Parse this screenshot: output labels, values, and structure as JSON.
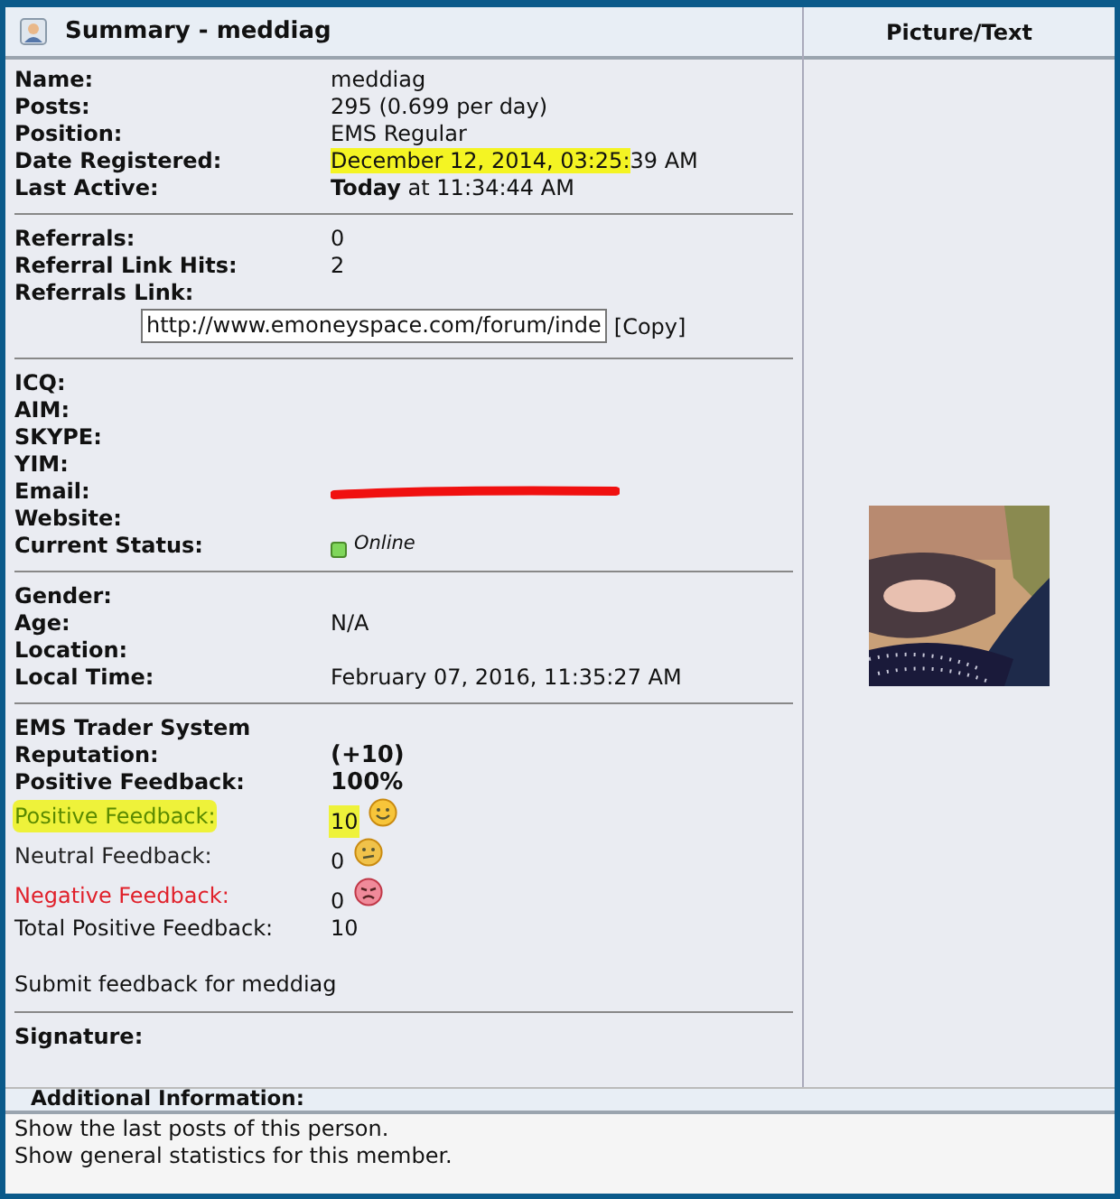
{
  "summary_header": {
    "title": "Summary - meddiag"
  },
  "picture_header": {
    "title": "Picture/Text"
  },
  "sections": [
    {
      "rows": [
        {
          "kind": "field",
          "label": "Name:",
          "value": "meddiag"
        },
        {
          "kind": "field",
          "label": "Posts:",
          "value": "295 (0.699 per day)"
        },
        {
          "kind": "field",
          "label": "Position:",
          "value": "EMS Regular"
        },
        {
          "kind": "highlighted_field",
          "label": "Date Registered:",
          "value_parts": [
            {
              "text": "December 12, 2014, 03:25:",
              "highlighted": true
            },
            {
              "text": "39 AM",
              "highlighted": false
            }
          ]
        },
        {
          "kind": "field",
          "label": "Last Active:",
          "value": "**Today** at 11:34:44 AM"
        }
      ]
    },
    {
      "rows": [
        {
          "kind": "field",
          "label": "Referrals:",
          "value": "0"
        },
        {
          "kind": "field",
          "label": "Referral Link Hits:",
          "value": "2"
        },
        {
          "kind": "link_input",
          "label": "Referrals Link:",
          "value": "http://www.emoneyspace.com/forum/inde",
          "action": "[Copy]"
        }
      ]
    },
    {
      "rows": [
        {
          "kind": "field",
          "label": "ICQ:"
        },
        {
          "kind": "field",
          "label": "AIM:"
        },
        {
          "kind": "field",
          "label": "SKYPE:"
        },
        {
          "kind": "field",
          "label": "YIM:"
        },
        {
          "kind": "redacted",
          "label": "Email:"
        },
        {
          "kind": "field",
          "label": "Website:"
        },
        {
          "kind": "status",
          "label": "Current Status:",
          "value": "Online",
          "online": true
        }
      ]
    },
    {
      "rows": [
        {
          "kind": "field",
          "label": "Gender:"
        },
        {
          "kind": "field",
          "label": "Age:",
          "value": "N/A"
        },
        {
          "kind": "field",
          "label": "Location:"
        },
        {
          "kind": "field",
          "label": "Local Time:",
          "value": "February 07, 2016, 11:35:27 AM"
        }
      ]
    },
    {
      "rows": [
        {
          "kind": "heading",
          "label": "EMS Trader System"
        },
        {
          "kind": "bold_field",
          "label": "Reputation:",
          "value": "(+10)"
        },
        {
          "kind": "bold_field",
          "label": "Positive Feedback:",
          "value": "100%"
        },
        {
          "kind": "positive_feedback",
          "label": "Positive Feedback:",
          "value": "10",
          "highlighted": true
        },
        {
          "kind": "neutral_feedback",
          "label": "Neutral Feedback:",
          "value": "0",
          "highlighted": false
        },
        {
          "kind": "negative_feedback",
          "label": "Negative Feedback:",
          "value": "0",
          "highlighted": false
        },
        {
          "kind": "plain_field",
          "label": "Total Positive Feedback:",
          "value": "10"
        },
        {
          "kind": "link",
          "label": "Submit feedback for meddiag"
        }
      ]
    },
    {
      "rows": [
        {
          "kind": "field",
          "label": "Signature:"
        }
      ]
    }
  ],
  "additional_info": {
    "title": "Additional Information:",
    "links": [
      "Show the last posts of this person.",
      "Show general statistics for this member."
    ]
  }
}
